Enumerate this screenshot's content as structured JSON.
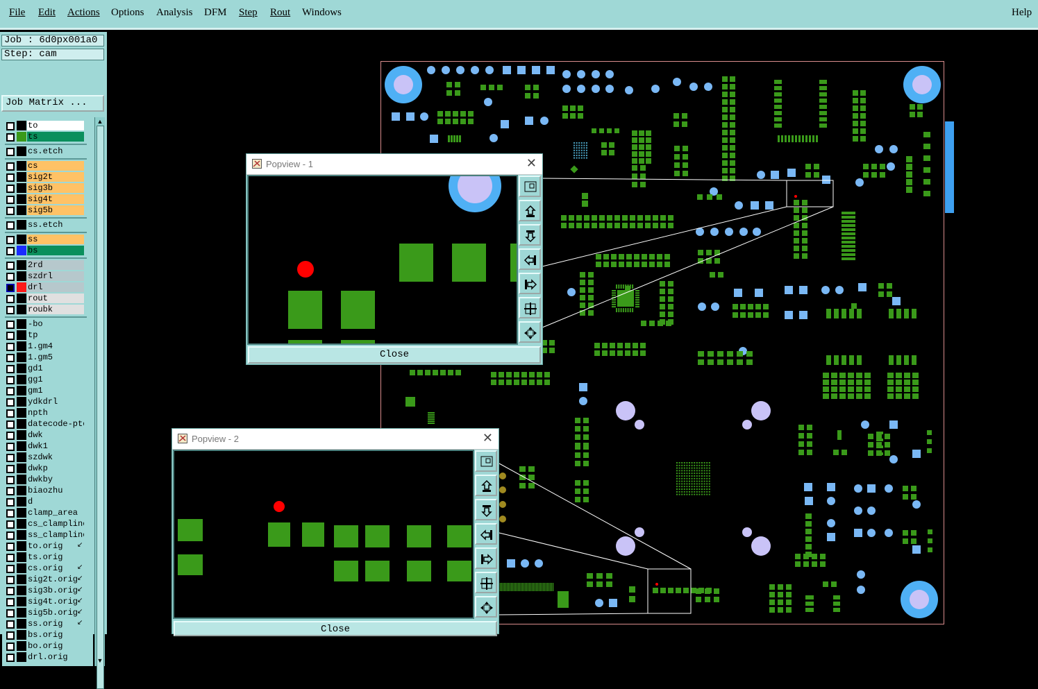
{
  "menu": {
    "items": [
      "File",
      "Edit",
      "Actions",
      "Options",
      "Analysis",
      "DFM",
      "Step",
      "Rout",
      "Windows"
    ],
    "help": "Help"
  },
  "panel": {
    "job": "Job : 6d0px001a0",
    "step": "Step: cam",
    "job_matrix": "Job Matrix ..."
  },
  "layers": [
    {
      "name": "to",
      "color": "#ffffff",
      "swatch": "#000000",
      "checked": false
    },
    {
      "name": "ts",
      "color": "#0a8f5c",
      "swatch": "#3a9a1a",
      "checked": false
    },
    {
      "name": "cs.etch",
      "color": "#9fd8d6",
      "swatch": "#000000",
      "checked": false
    },
    {
      "name": "cs",
      "color": "#ffc266",
      "swatch": "#000000",
      "checked": false
    },
    {
      "name": "sig2t",
      "color": "#ffc266",
      "swatch": "#000000",
      "checked": false
    },
    {
      "name": "sig3b",
      "color": "#ffc266",
      "swatch": "#000000",
      "checked": false
    },
    {
      "name": "sig4t",
      "color": "#ffc266",
      "swatch": "#000000",
      "checked": false
    },
    {
      "name": "sig5b",
      "color": "#ffc266",
      "swatch": "#000000",
      "checked": false
    },
    {
      "name": "ss.etch",
      "color": "#9fd8d6",
      "swatch": "#000000",
      "checked": false
    },
    {
      "name": "ss",
      "color": "#ffc266",
      "swatch": "#000000",
      "checked": false
    },
    {
      "name": "bs",
      "color": "#0a8f5c",
      "swatch": "#1a2bff",
      "checked": false
    },
    {
      "name": "2rd",
      "color": "#b6c8cc",
      "swatch": "#000000",
      "checked": false
    },
    {
      "name": "szdrl",
      "color": "#b6c8cc",
      "swatch": "#000000",
      "checked": false
    },
    {
      "name": "drl",
      "color": "#b6c8cc",
      "swatch": "#ff1a1a",
      "checked": true
    },
    {
      "name": "rout",
      "color": "#e0e0e0",
      "swatch": "#000000",
      "checked": false
    },
    {
      "name": "roubk",
      "color": "#e0e0e0",
      "swatch": "#000000",
      "checked": false
    },
    {
      "name": "-bo",
      "color": "#9fd8d6",
      "swatch": "#000000",
      "checked": false
    },
    {
      "name": "tp",
      "color": "#9fd8d6",
      "swatch": "#000000",
      "checked": false
    },
    {
      "name": "1.gm4",
      "color": "#9fd8d6",
      "swatch": "#000000",
      "checked": false
    },
    {
      "name": "1.gm5",
      "color": "#9fd8d6",
      "swatch": "#000000",
      "checked": false
    },
    {
      "name": "gd1",
      "color": "#9fd8d6",
      "swatch": "#000000",
      "checked": false
    },
    {
      "name": "gg1",
      "color": "#9fd8d6",
      "swatch": "#000000",
      "checked": false
    },
    {
      "name": "gm1",
      "color": "#9fd8d6",
      "swatch": "#000000",
      "checked": false
    },
    {
      "name": "ydkdrl",
      "color": "#9fd8d6",
      "swatch": "#000000",
      "checked": false
    },
    {
      "name": "npth",
      "color": "#9fd8d6",
      "swatch": "#000000",
      "checked": false
    },
    {
      "name": "datecode-pto",
      "color": "#9fd8d6",
      "swatch": "#000000",
      "checked": false
    },
    {
      "name": "dwk",
      "color": "#9fd8d6",
      "swatch": "#000000",
      "checked": false
    },
    {
      "name": "dwk1",
      "color": "#9fd8d6",
      "swatch": "#000000",
      "checked": false
    },
    {
      "name": "szdwk",
      "color": "#9fd8d6",
      "swatch": "#000000",
      "checked": false
    },
    {
      "name": "dwkp",
      "color": "#9fd8d6",
      "swatch": "#000000",
      "checked": false
    },
    {
      "name": "dwkby",
      "color": "#9fd8d6",
      "swatch": "#000000",
      "checked": false
    },
    {
      "name": "biaozhu",
      "color": "#9fd8d6",
      "swatch": "#000000",
      "checked": false
    },
    {
      "name": "d",
      "color": "#9fd8d6",
      "swatch": "#000000",
      "checked": false
    },
    {
      "name": "clamp_area",
      "color": "#9fd8d6",
      "swatch": "#000000",
      "checked": false
    },
    {
      "name": "cs_clampline",
      "color": "#9fd8d6",
      "swatch": "#000000",
      "checked": false
    },
    {
      "name": "ss_clampline",
      "color": "#9fd8d6",
      "swatch": "#000000",
      "checked": false
    },
    {
      "name": "to.orig",
      "color": "#9fd8d6",
      "swatch": "#000000",
      "checked": false
    },
    {
      "name": "ts.orig",
      "color": "#9fd8d6",
      "swatch": "#000000",
      "checked": false
    },
    {
      "name": "cs.orig",
      "color": "#9fd8d6",
      "swatch": "#000000",
      "checked": false
    },
    {
      "name": "sig2t.orig",
      "color": "#9fd8d6",
      "swatch": "#000000",
      "checked": false
    },
    {
      "name": "sig3b.orig",
      "color": "#9fd8d6",
      "swatch": "#000000",
      "checked": false
    },
    {
      "name": "sig4t.orig",
      "color": "#9fd8d6",
      "swatch": "#000000",
      "checked": false
    },
    {
      "name": "sig5b.orig",
      "color": "#9fd8d6",
      "swatch": "#000000",
      "checked": false
    },
    {
      "name": "ss.orig",
      "color": "#9fd8d6",
      "swatch": "#000000",
      "checked": false
    },
    {
      "name": "bs.orig",
      "color": "#9fd8d6",
      "swatch": "#000000",
      "checked": false
    },
    {
      "name": "bo.orig",
      "color": "#9fd8d6",
      "swatch": "#000000",
      "checked": false
    },
    {
      "name": "drl.orig",
      "color": "#9fd8d6",
      "swatch": "#000000",
      "checked": false
    }
  ],
  "popups": [
    {
      "title": "Popview - 1",
      "close_label": "Close"
    },
    {
      "title": "Popview - 2",
      "close_label": "Close"
    }
  ],
  "colors": {
    "panel_bg": "#9fd8d6",
    "pad_green": "#3a9a1a",
    "pad_blue": "#7ab8f5",
    "pad_lavender": "#c9c3f7",
    "drill_red": "#ff0000",
    "board_outline": "#d98c8c"
  }
}
